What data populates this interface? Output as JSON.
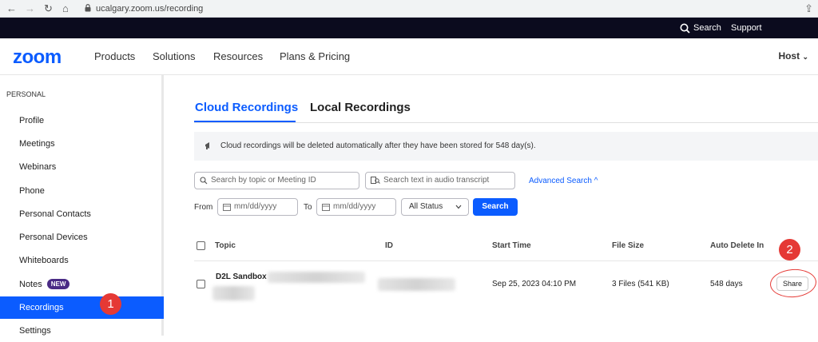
{
  "browser": {
    "url": "ucalgary.zoom.us/recording"
  },
  "topbar": {
    "search_label": "Search",
    "support_label": "Support"
  },
  "nav": {
    "logo": "zoom",
    "links": [
      "Products",
      "Solutions",
      "Resources",
      "Plans & Pricing"
    ],
    "host_label": "Host"
  },
  "sidebar": {
    "section": "PERSONAL",
    "items": [
      {
        "label": "Profile"
      },
      {
        "label": "Meetings"
      },
      {
        "label": "Webinars"
      },
      {
        "label": "Phone"
      },
      {
        "label": "Personal Contacts"
      },
      {
        "label": "Personal Devices"
      },
      {
        "label": "Whiteboards"
      },
      {
        "label": "Notes",
        "badge": "NEW"
      },
      {
        "label": "Recordings",
        "active": true
      },
      {
        "label": "Settings"
      }
    ]
  },
  "annotations": {
    "one": "1",
    "two": "2"
  },
  "tabs": {
    "cloud": "Cloud Recordings",
    "local": "Local Recordings"
  },
  "notice": "Cloud recordings will be deleted automatically after they have been stored for 548 day(s).",
  "filters": {
    "topic_placeholder": "Search by topic or Meeting ID",
    "transcript_placeholder": "Search text in audio transcript",
    "advanced": "Advanced Search ^",
    "from_label": "From",
    "to_label": "To",
    "date_placeholder": "mm/dd/yyyy",
    "status_value": "All Status",
    "search_button": "Search"
  },
  "table": {
    "headers": {
      "topic": "Topic",
      "id": "ID",
      "start": "Start Time",
      "size": "File Size",
      "auto_delete": "Auto Delete In"
    },
    "rows": [
      {
        "topic": "D2L Sandbox",
        "start": "Sep 25, 2023 04:10 PM",
        "size": "3 Files (541 KB)",
        "auto_delete": "548 days",
        "action": "Share"
      }
    ]
  },
  "colors": {
    "brand": "#0b5cff",
    "topbar": "#0b0b1e",
    "annotation": "#e53935",
    "badge": "#4a2b85"
  }
}
